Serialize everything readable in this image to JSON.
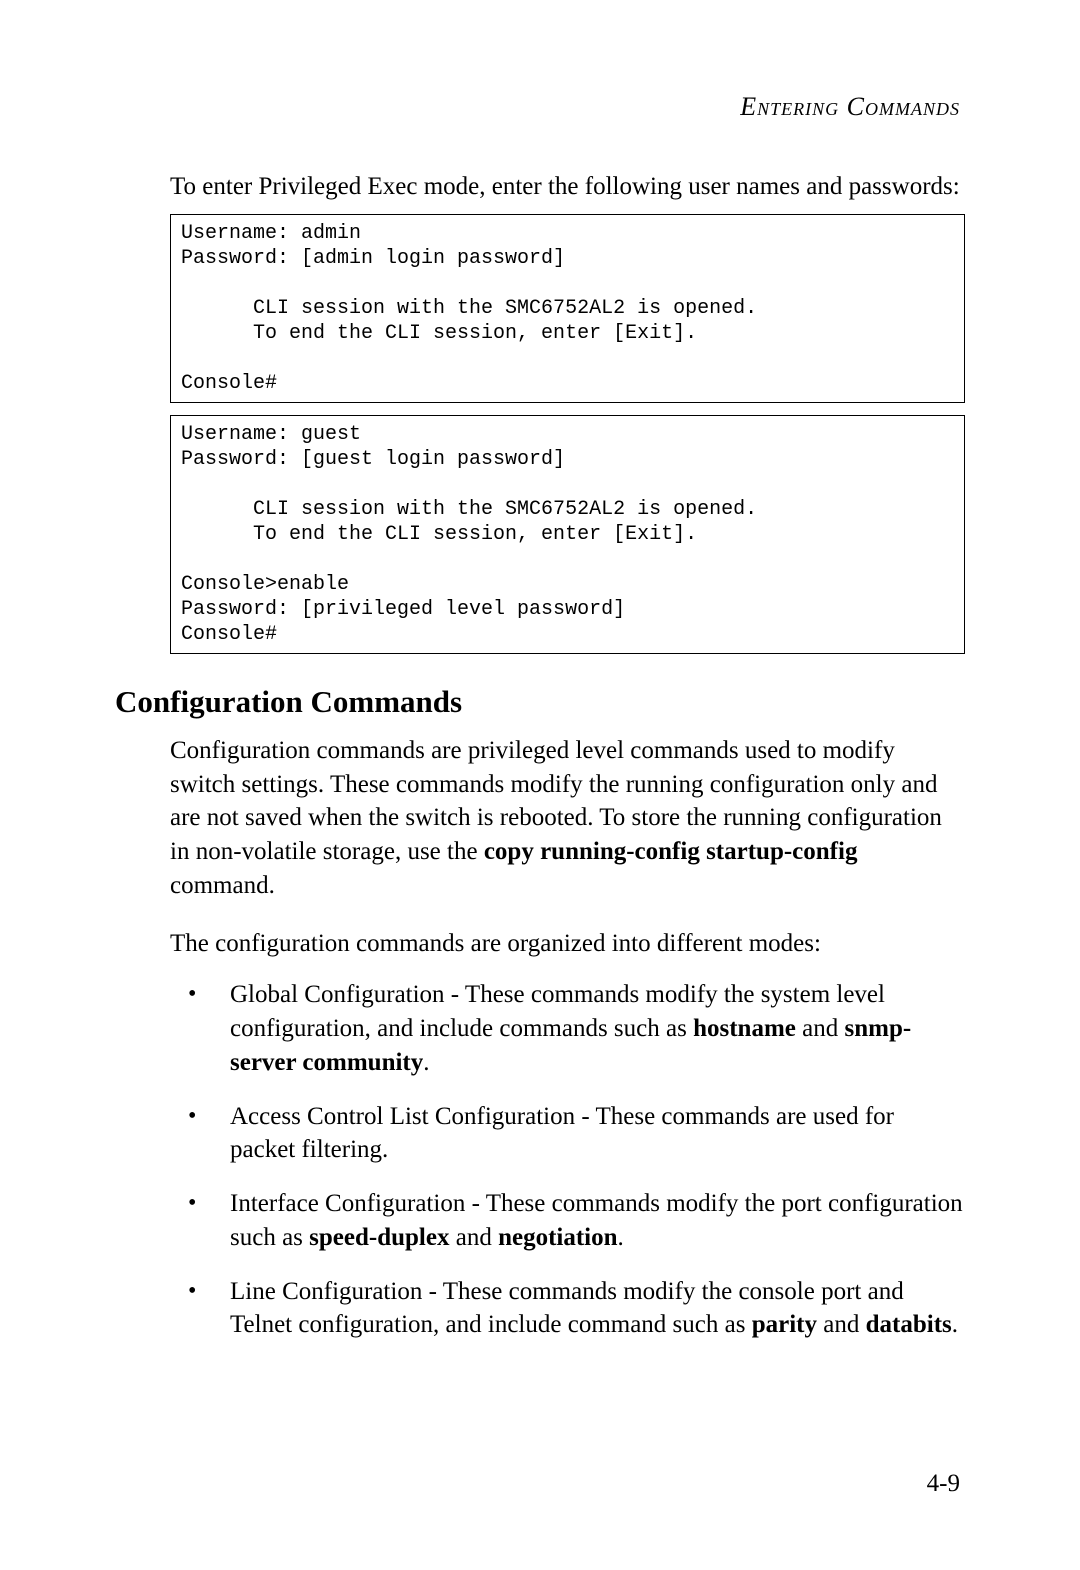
{
  "header": {
    "title": "Entering Commands"
  },
  "intro": "To enter Privileged Exec mode, enter the following user names and passwords:",
  "code1": "Username: admin\nPassword: [admin login password]\n\n      CLI session with the SMC6752AL2 is opened.\n      To end the CLI session, enter [Exit].\n\nConsole#",
  "code2": "Username: guest\nPassword: [guest login password]\n\n      CLI session with the SMC6752AL2 is opened.\n      To end the CLI session, enter [Exit].\n\nConsole>enable\nPassword: [privileged level password]\nConsole#",
  "section": {
    "title": "Configuration Commands",
    "p1a": "Configuration commands are privileged level commands used to modify switch settings. These commands modify the running configuration only and are not saved when the switch is rebooted. To store the running configuration in non-volatile storage, use the ",
    "p1b": "copy running-config startup-config",
    "p1c": " command.",
    "p2": "The configuration commands are organized into different modes:",
    "bullets": {
      "b1a": "Global Configuration - These commands modify the system level configuration, and include commands such as ",
      "b1b": "hostname",
      "b1c": " and ",
      "b1d": "snmp-server community",
      "b1e": ".",
      "b2": "Access Control List Configuration - These commands are used for packet filtering.",
      "b3a": "Interface Configuration - These commands modify the port configuration such as ",
      "b3b": "speed-duplex",
      "b3c": " and ",
      "b3d": "negotiation",
      "b3e": ".",
      "b4a": "Line Configuration - These commands modify the console port and Telnet configuration, and include command such as ",
      "b4b": "parity",
      "b4c": " and ",
      "b4d": "databits",
      "b4e": "."
    }
  },
  "pageNumber": "4-9"
}
